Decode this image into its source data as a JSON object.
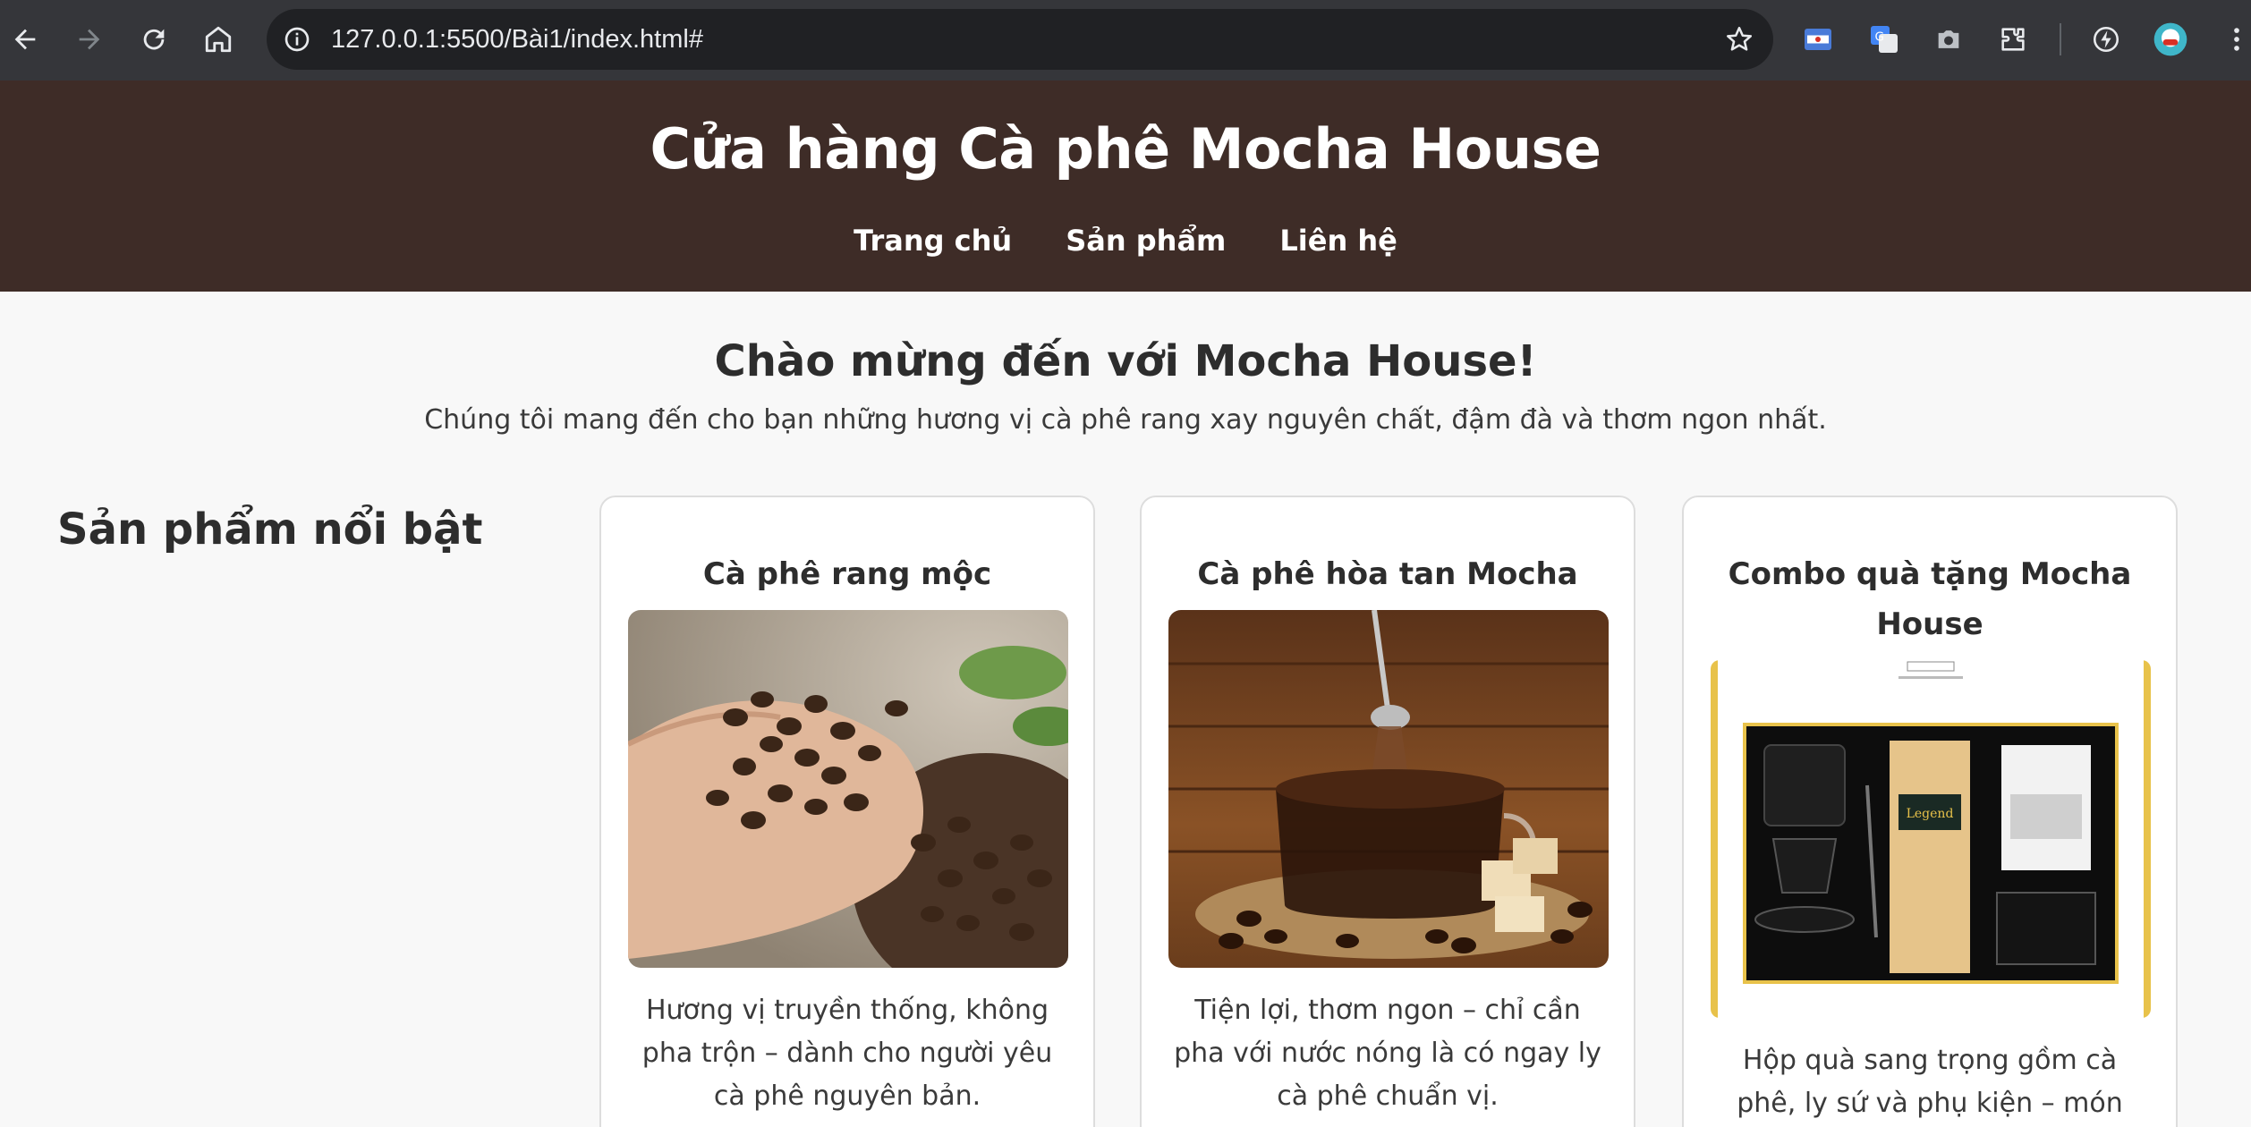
{
  "browser": {
    "url": "127.0.0.1:5500/Bài1/index.html#",
    "icons": [
      "back-icon",
      "forward-icon",
      "reload-icon",
      "home-icon",
      "site-info-icon",
      "bookmark-star-icon",
      "extension-meet-icon",
      "extension-translate-icon",
      "extension-camera-icon",
      "extensions-puzzle-icon",
      "performance-icon",
      "profile-avatar-icon"
    ]
  },
  "header": {
    "title": "Cửa hàng Cà phê Mocha House",
    "nav": [
      "Trang chủ",
      "Sản phẩm",
      "Liên hệ"
    ]
  },
  "welcome": {
    "title": "Chào mừng đến với Mocha House!",
    "text": "Chúng tôi mang đến cho bạn những hương vị cà phê rang xay nguyên chất, đậm đà và thơm ngon nhất."
  },
  "featured": {
    "title": "Sản phẩm nổi bật",
    "products": [
      {
        "name": "Cà phê rang mộc",
        "description": "Hương vị truyền thống, không pha trộn – dành cho người yêu cà phê nguyên bản.",
        "image": "coffee-beans-in-hand-image"
      },
      {
        "name": "Cà phê hòa tan Mocha",
        "description": "Tiện lợi, thơm ngon – chỉ cần pha với nước nóng là có ngay ly cà phê chuẩn vị.",
        "image": "instant-coffee-cup-image"
      },
      {
        "name": "Combo quà tặng Mocha House",
        "description": "Hộp quà sang trọng gồm cà phê, ly sứ và phụ kiện – món quà ý nghĩa",
        "image": "gift-box-image",
        "box_text": "Legend"
      }
    ]
  },
  "colors": {
    "header_bg": "#3e2c27",
    "page_bg": "#f8f8f8",
    "chrome_bg": "#35363a",
    "omnibox_bg": "#202124"
  }
}
